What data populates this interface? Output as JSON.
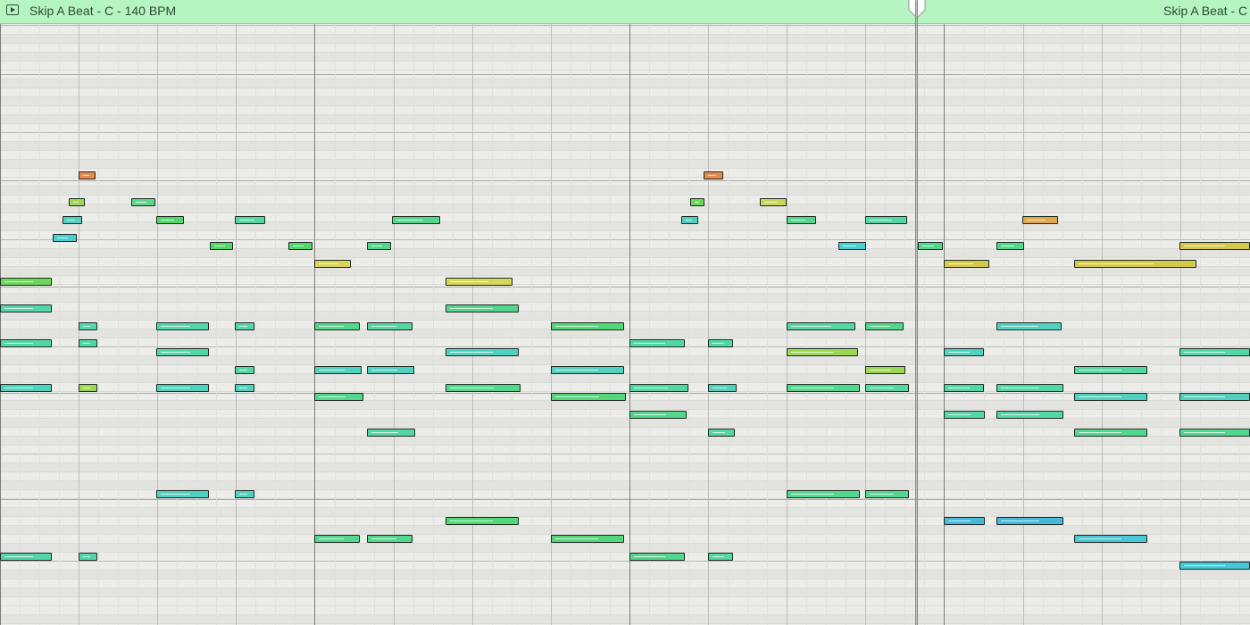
{
  "region": {
    "title": "Skip A Beat - C - 140 BPM",
    "title_repeat": "Skip A Beat - C",
    "play_icon": "region-play-icon"
  },
  "colors": {
    "header": "#b6f4c2",
    "grid_bg": "#ecece8",
    "grid_alt": "#e3e3df"
  },
  "notes": [
    {
      "p": [
        88,
        192,
        19
      ],
      "c": "#e38a50"
    },
    {
      "p": [
        788,
        192,
        22
      ],
      "c": "#e38a50"
    },
    {
      "p": [
        77,
        222,
        18
      ],
      "c": "#9dd855"
    },
    {
      "p": [
        147,
        222,
        27
      ],
      "c": "#5fd68a"
    },
    {
      "p": [
        773,
        222,
        16
      ],
      "c": "#6cd65a"
    },
    {
      "p": [
        851,
        222,
        30
      ],
      "c": "#c9d65a"
    },
    {
      "p": [
        70,
        242,
        22
      ],
      "c": "#4fd2c0"
    },
    {
      "p": [
        175,
        242,
        31
      ],
      "c": "#52d86a"
    },
    {
      "p": [
        263,
        242,
        34
      ],
      "c": "#52d8a0"
    },
    {
      "p": [
        439,
        242,
        54
      ],
      "c": "#52d88c"
    },
    {
      "p": [
        763,
        242,
        19
      ],
      "c": "#4fd2c0"
    },
    {
      "p": [
        881,
        242,
        33
      ],
      "c": "#52d88c"
    },
    {
      "p": [
        969,
        242,
        47
      ],
      "c": "#52d8a8"
    },
    {
      "p": [
        1145,
        242,
        40
      ],
      "c": "#e0a84a"
    },
    {
      "p": [
        59,
        262,
        27
      ],
      "c": "#47cfd2"
    },
    {
      "p": [
        235,
        271,
        26
      ],
      "c": "#52d86a"
    },
    {
      "p": [
        323,
        271,
        27
      ],
      "c": "#52d86a"
    },
    {
      "p": [
        411,
        271,
        27
      ],
      "c": "#52d88c"
    },
    {
      "p": [
        939,
        271,
        31
      ],
      "c": "#47cfd2"
    },
    {
      "p": [
        1028,
        271,
        28
      ],
      "c": "#52d88c"
    },
    {
      "p": [
        1116,
        271,
        31
      ],
      "c": "#52d88c"
    },
    {
      "p": [
        352,
        291,
        41
      ],
      "c": "#d6d65a"
    },
    {
      "p": [
        1057,
        291,
        51
      ],
      "c": "#d6c94a"
    },
    {
      "p": [
        1203,
        291,
        137
      ],
      "c": "#d6c94a"
    },
    {
      "p": [
        1321,
        271,
        79
      ],
      "c": "#d6c94a"
    },
    {
      "p": [
        0,
        311,
        58
      ],
      "c": "#6ed65a"
    },
    {
      "p": [
        499,
        311,
        75
      ],
      "c": "#d6d65a"
    },
    {
      "p": [
        0,
        341,
        58
      ],
      "c": "#52d8a8"
    },
    {
      "p": [
        499,
        341,
        82
      ],
      "c": "#52d88c"
    },
    {
      "p": [
        88,
        361,
        21
      ],
      "c": "#52d8a8"
    },
    {
      "p": [
        175,
        361,
        59
      ],
      "c": "#52d8a8"
    },
    {
      "p": [
        263,
        361,
        22
      ],
      "c": "#52d8a8"
    },
    {
      "p": [
        352,
        361,
        51
      ],
      "c": "#52d88c"
    },
    {
      "p": [
        411,
        361,
        51
      ],
      "c": "#52d8a0"
    },
    {
      "p": [
        617,
        361,
        82
      ],
      "c": "#52d878"
    },
    {
      "p": [
        881,
        361,
        77
      ],
      "c": "#52d8a0"
    },
    {
      "p": [
        969,
        361,
        43
      ],
      "c": "#52d88c"
    },
    {
      "p": [
        1116,
        361,
        73
      ],
      "c": "#4fd2c0"
    },
    {
      "p": [
        0,
        380,
        58
      ],
      "c": "#52d8a8"
    },
    {
      "p": [
        88,
        380,
        21
      ],
      "c": "#52d8a8"
    },
    {
      "p": [
        705,
        380,
        62
      ],
      "c": "#52d8a8"
    },
    {
      "p": [
        793,
        380,
        28
      ],
      "c": "#52d8a8"
    },
    {
      "p": [
        175,
        390,
        59
      ],
      "c": "#52d8a8"
    },
    {
      "p": [
        499,
        390,
        82
      ],
      "c": "#4fd2c0"
    },
    {
      "p": [
        881,
        390,
        80
      ],
      "c": "#9dd855"
    },
    {
      "p": [
        1057,
        390,
        45
      ],
      "c": "#4fd2c0"
    },
    {
      "p": [
        1321,
        390,
        79
      ],
      "c": "#52d8a8"
    },
    {
      "p": [
        263,
        410,
        22
      ],
      "c": "#52d8a8"
    },
    {
      "p": [
        352,
        410,
        53
      ],
      "c": "#4fd2c0"
    },
    {
      "p": [
        411,
        410,
        53
      ],
      "c": "#4fd2c0"
    },
    {
      "p": [
        617,
        410,
        82
      ],
      "c": "#4fd2c0"
    },
    {
      "p": [
        969,
        410,
        45
      ],
      "c": "#9dd855"
    },
    {
      "p": [
        1203,
        410,
        82
      ],
      "c": "#52d8a0"
    },
    {
      "p": [
        0,
        430,
        58
      ],
      "c": "#4fd2c0"
    },
    {
      "p": [
        88,
        430,
        21
      ],
      "c": "#9dd855"
    },
    {
      "p": [
        175,
        430,
        59
      ],
      "c": "#4fd2c0"
    },
    {
      "p": [
        263,
        430,
        22
      ],
      "c": "#4fd2c0"
    },
    {
      "p": [
        499,
        430,
        84
      ],
      "c": "#52d88c"
    },
    {
      "p": [
        705,
        430,
        66
      ],
      "c": "#52d8a0"
    },
    {
      "p": [
        793,
        430,
        32
      ],
      "c": "#4fd2c0"
    },
    {
      "p": [
        881,
        430,
        82
      ],
      "c": "#52d88c"
    },
    {
      "p": [
        969,
        430,
        49
      ],
      "c": "#52d8a0"
    },
    {
      "p": [
        1057,
        430,
        45
      ],
      "c": "#52d8a8"
    },
    {
      "p": [
        1116,
        430,
        75
      ],
      "c": "#52d8a8"
    },
    {
      "p": [
        352,
        440,
        55
      ],
      "c": "#52d88c"
    },
    {
      "p": [
        617,
        440,
        84
      ],
      "c": "#52d878"
    },
    {
      "p": [
        1203,
        440,
        82
      ],
      "c": "#4fd2c0"
    },
    {
      "p": [
        1321,
        440,
        79
      ],
      "c": "#4fd2c0"
    },
    {
      "p": [
        705,
        460,
        64
      ],
      "c": "#52d88c"
    },
    {
      "p": [
        1057,
        460,
        46
      ],
      "c": "#52d8a8"
    },
    {
      "p": [
        1116,
        460,
        75
      ],
      "c": "#52d8a8"
    },
    {
      "p": [
        411,
        480,
        54
      ],
      "c": "#52d8a8"
    },
    {
      "p": [
        793,
        480,
        30
      ],
      "c": "#52d8a0"
    },
    {
      "p": [
        1203,
        480,
        82
      ],
      "c": "#52d88c"
    },
    {
      "p": [
        1321,
        480,
        79
      ],
      "c": "#52d88c"
    },
    {
      "p": [
        175,
        549,
        59
      ],
      "c": "#4fd2c0"
    },
    {
      "p": [
        263,
        549,
        22
      ],
      "c": "#4fd2c0"
    },
    {
      "p": [
        881,
        549,
        82
      ],
      "c": "#52d88c"
    },
    {
      "p": [
        969,
        549,
        49
      ],
      "c": "#52d88c"
    },
    {
      "p": [
        499,
        579,
        82
      ],
      "c": "#52d878"
    },
    {
      "p": [
        1057,
        579,
        46
      ],
      "c": "#47b8d8"
    },
    {
      "p": [
        1116,
        579,
        75
      ],
      "c": "#47b8d8"
    },
    {
      "p": [
        352,
        599,
        51
      ],
      "c": "#52d88c"
    },
    {
      "p": [
        411,
        599,
        51
      ],
      "c": "#52d88c"
    },
    {
      "p": [
        617,
        599,
        82
      ],
      "c": "#52d878"
    },
    {
      "p": [
        1203,
        599,
        82
      ],
      "c": "#47c8d8"
    },
    {
      "p": [
        0,
        619,
        58
      ],
      "c": "#52d8a8"
    },
    {
      "p": [
        88,
        619,
        21
      ],
      "c": "#52d8a8"
    },
    {
      "p": [
        705,
        619,
        62
      ],
      "c": "#52d88c"
    },
    {
      "p": [
        793,
        619,
        28
      ],
      "c": "#52d8a0"
    },
    {
      "p": [
        1321,
        629,
        79
      ],
      "c": "#47c8d8"
    }
  ]
}
